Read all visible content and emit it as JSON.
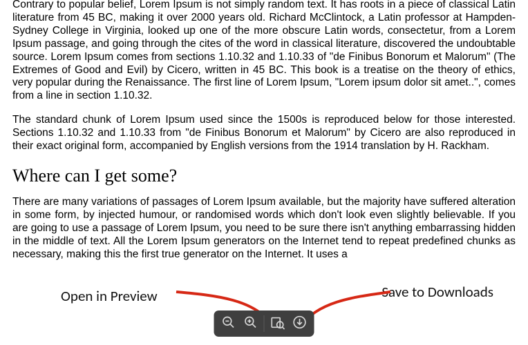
{
  "document": {
    "para1": "Contrary to popular belief, Lorem Ipsum is not simply random text. It has roots in a piece of classical Latin literature from 45 BC, making it over 2000 years old. Richard McClintock, a Latin professor at Hampden-Sydney College in Virginia, looked up one of the more obscure Latin words, consectetur, from a Lorem Ipsum passage, and going through the cites of the word in classical literature, discovered the undoubtable source. Lorem Ipsum comes from sections 1.10.32 and 1.10.33 of \"de Finibus Bonorum et Malorum\" (The Extremes of Good and Evil) by Cicero, written in 45 BC. This book is a treatise on the theory of ethics, very popular during the Renaissance. The first line of Lorem Ipsum, \"Lorem ipsum dolor sit amet..\", comes from a line in section 1.10.32.",
    "para2": "The standard chunk of Lorem Ipsum used since the 1500s is reproduced below for those interested. Sections 1.10.32 and 1.10.33 from \"de Finibus Bonorum et Malorum\" by Cicero are also reproduced in their exact original form, accompanied by English versions from the 1914 translation by H. Rackham.",
    "heading": "Where can I get some?",
    "para3": "There are many variations of passages of Lorem Ipsum available, but the majority have suffered alteration in some form, by injected humour, or randomised words which don't look even slightly believable. If you are going to use a passage of Lorem Ipsum, you need to be sure there isn't anything embarrassing hidden in the middle of text. All the Lorem Ipsum generators on the Internet tend to repeat predefined chunks as necessary, making this the first true generator on the Internet. It uses a"
  },
  "annotations": {
    "left": "Open in Preview",
    "right": "Save to Downloads"
  },
  "toolbar": {
    "zoom_out": "zoom-out",
    "zoom_in": "zoom-in",
    "open_preview": "open-in-preview",
    "save_downloads": "save-to-downloads"
  },
  "colors": {
    "arrow": "#d62815",
    "toolbar_bg": "#3f3f3f"
  }
}
